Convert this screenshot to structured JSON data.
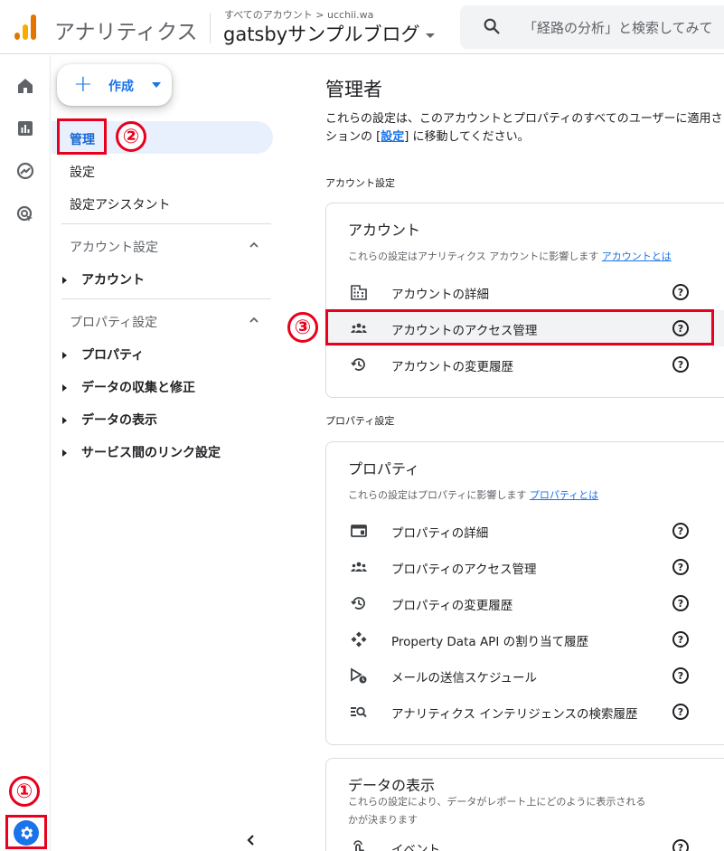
{
  "header": {
    "app_title": "アナリティクス",
    "breadcrumb": "すべてのアカウント > ucchii.wa",
    "property_name": "gatsbyサンプルブログ",
    "search_placeholder": "「経路の分析」と検索してみて"
  },
  "rail": {
    "items": [
      "home-icon",
      "reports-icon",
      "explore-icon",
      "advertising-icon"
    ],
    "admin_icon": "gear-icon"
  },
  "nav": {
    "create_label": "作成",
    "items": [
      {
        "label": "管理",
        "active": true
      },
      {
        "label": "設定"
      },
      {
        "label": "設定アシスタント"
      }
    ],
    "sections": [
      {
        "label": "アカウント設定",
        "items": [
          "アカウント"
        ]
      },
      {
        "label": "プロパティ設定",
        "items": [
          "プロパティ",
          "データの収集と修正",
          "データの表示",
          "サービス間のリンク設定"
        ]
      }
    ]
  },
  "annotations": {
    "one": "①",
    "two": "②",
    "three": "③",
    "accent": "#e8001c"
  },
  "main": {
    "title": "管理者",
    "desc_before": "これらの設定は、このアカウントとプロパティのすべてのユーザーに適用されます。個人の設定については、セク",
    "desc_line2_before": "ションの [",
    "desc_link": "設定",
    "desc_line2_after": "] に移動してください。",
    "account_section_label": "アカウント設定",
    "account_card": {
      "title": "アカウント",
      "desc": "これらの設定はアナリティクス アカウントに影響します",
      "link": "アカウントとは",
      "rows": [
        {
          "icon": "building-icon",
          "label": "アカウントの詳細"
        },
        {
          "icon": "group-icon",
          "label": "アカウントのアクセス管理",
          "highlighted": true
        },
        {
          "icon": "history-icon",
          "label": "アカウントの変更履歴"
        }
      ]
    },
    "property_section_label": "プロパティ設定",
    "property_card": {
      "title": "プロパティ",
      "desc": "これらの設定はプロパティに影響します",
      "link": "プロパティとは",
      "rows": [
        {
          "icon": "details-icon",
          "label": "プロパティの詳細"
        },
        {
          "icon": "group-icon",
          "label": "プロパティのアクセス管理"
        },
        {
          "icon": "history-icon",
          "label": "プロパティの変更履歴"
        },
        {
          "icon": "api-icon",
          "label": "Property Data API の割り当て履歴"
        },
        {
          "icon": "scheduled-email-icon",
          "label": "メールの送信スケジュール"
        },
        {
          "icon": "search-history-icon",
          "label": "アナリティクス インテリジェンスの検索履歴"
        }
      ]
    },
    "display_card": {
      "title": "データの表示",
      "desc_line1": "これらの設定により、データがレポート上にどのように表示される",
      "desc_line2": "かが決まります",
      "rows": [
        {
          "icon": "event-icon",
          "label": "イベント"
        }
      ]
    },
    "help_glyph": "?"
  }
}
